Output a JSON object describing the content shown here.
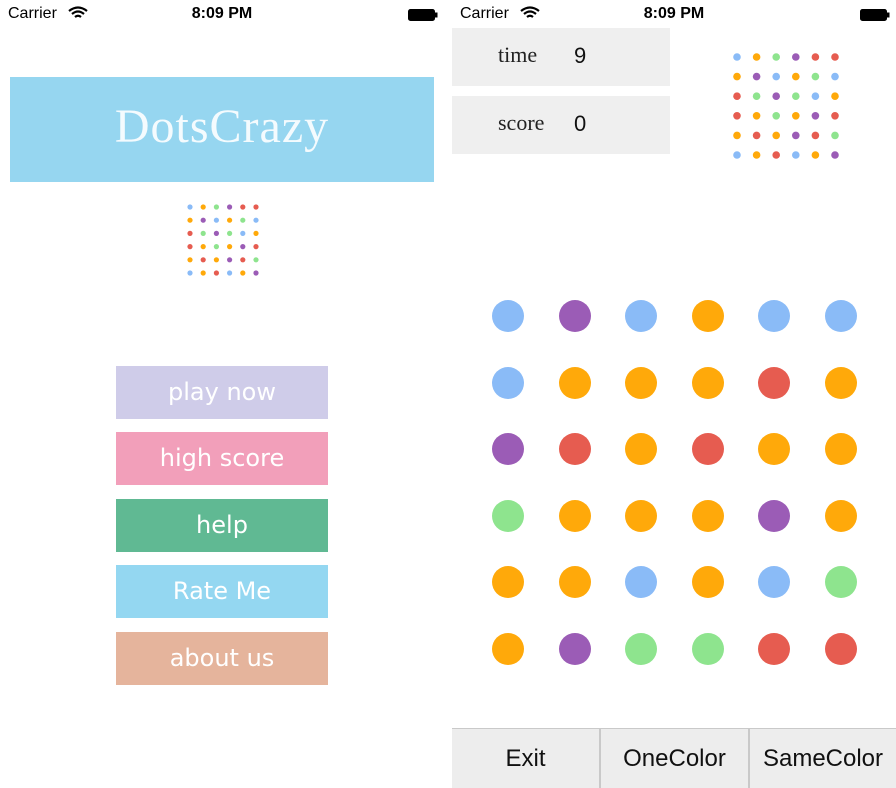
{
  "status_bar": {
    "carrier": "Carrier",
    "time": "8:09 PM"
  },
  "home": {
    "title": "DotsCrazy",
    "buttons": [
      {
        "label": "play now",
        "color": "#cfcce9"
      },
      {
        "label": "high score",
        "color": "#f29fba"
      },
      {
        "label": "help",
        "color": "#60b993"
      },
      {
        "label": "Rate Me",
        "color": "#94d7f1"
      },
      {
        "label": "about us",
        "color": "#e5b49c"
      }
    ]
  },
  "game": {
    "time_label": "time",
    "time_value": "9",
    "score_label": "score",
    "score_value": "0",
    "board": [
      [
        "blue",
        "purple",
        "blue",
        "orange",
        "blue",
        "blue"
      ],
      [
        "blue",
        "orange",
        "orange",
        "orange",
        "red",
        "orange"
      ],
      [
        "purple",
        "red",
        "orange",
        "red",
        "orange",
        "orange"
      ],
      [
        "green",
        "orange",
        "orange",
        "orange",
        "purple",
        "orange"
      ],
      [
        "orange",
        "orange",
        "blue",
        "orange",
        "blue",
        "green"
      ],
      [
        "orange",
        "purple",
        "green",
        "green",
        "red",
        "red"
      ]
    ],
    "bottom_buttons": [
      "Exit",
      "OneColor",
      "SameColor"
    ]
  },
  "dot_colors": {
    "blue": "#8abbf7",
    "purple": "#9b5cb6",
    "orange": "#ffa90a",
    "red": "#e65c50",
    "green": "#8ee48e"
  },
  "logo_grid": [
    [
      "blue",
      "orange",
      "green",
      "purple",
      "red",
      "red"
    ],
    [
      "orange",
      "purple",
      "blue",
      "orange",
      "green",
      "blue"
    ],
    [
      "red",
      "green",
      "purple",
      "green",
      "blue",
      "orange"
    ],
    [
      "red",
      "orange",
      "green",
      "orange",
      "purple",
      "red"
    ],
    [
      "orange",
      "red",
      "orange",
      "purple",
      "red",
      "green"
    ],
    [
      "blue",
      "orange",
      "red",
      "blue",
      "orange",
      "purple"
    ]
  ]
}
